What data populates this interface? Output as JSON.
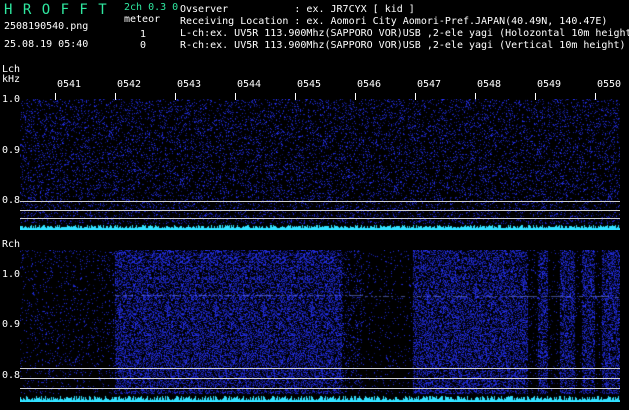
{
  "header": {
    "app_title": "H R O F F T",
    "channel_mode": "2ch 0.3 0",
    "filename": "2508190540.png",
    "meteor_label": "meteor",
    "datetime": "25.08.19 05:40",
    "meteor_count_l": "1",
    "meteor_count_r": "0"
  },
  "info": {
    "observer": "Ovserver           : ex. JR7CYX [ kid ]",
    "location": "Receiving Location : ex. Aomori City Aomori-Pref.JAPAN(40.49N, 140.47E)",
    "lch": "L-ch:ex. UV5R 113.900Mhz(SAPPORO VOR)USB ,2-ele yagi (Holozontal 10m height)",
    "rch": "R-ch:ex. UV5R 113.900Mhz(SAPPORO VOR)USB ,2-ele yagi (Vertical 10m height)"
  },
  "panels": {
    "lch_label": "Lch",
    "unit": "kHz",
    "rch_label": "Rch",
    "time_labels": [
      "0541",
      "0542",
      "0543",
      "0544",
      "0545",
      "0546",
      "0547",
      "0548",
      "0549",
      "0550"
    ],
    "lch_freq_labels": [
      "1.0",
      "0.9",
      "0.8"
    ],
    "rch_freq_labels": [
      "1.0",
      "0.9",
      "0.8"
    ]
  },
  "colors": {
    "background": "#000000",
    "title_green": "#2fe8a0",
    "waterfall_blue": "#2030c0",
    "signal_cyan": "#30e0ff"
  }
}
